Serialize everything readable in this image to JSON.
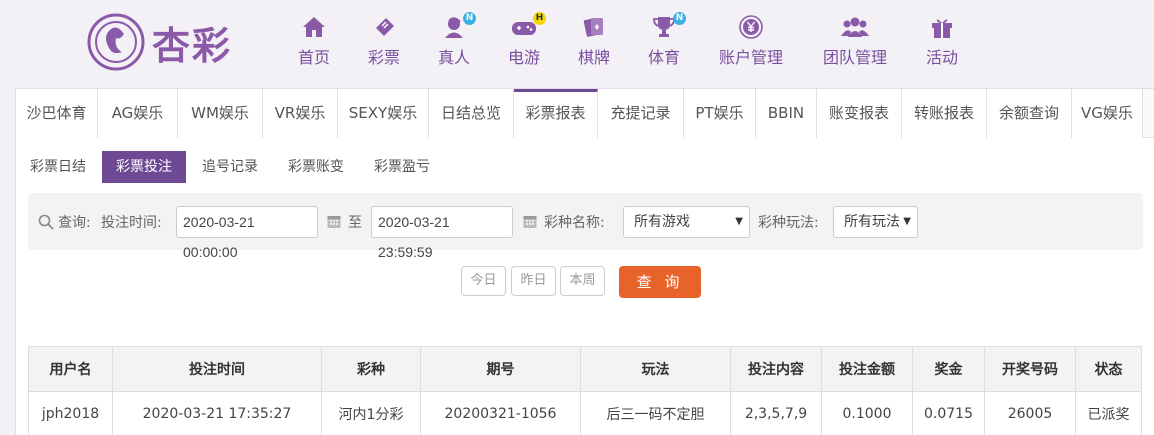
{
  "brand": {
    "name": "杏彩"
  },
  "nav": [
    {
      "label": "首页",
      "icon": "home-icon",
      "badge": ""
    },
    {
      "label": "彩票",
      "icon": "ticket-icon",
      "badge": ""
    },
    {
      "label": "真人",
      "icon": "live-dealer-icon",
      "badge": "N"
    },
    {
      "label": "电游",
      "icon": "gamepad-icon",
      "badge": "H"
    },
    {
      "label": "棋牌",
      "icon": "cards-icon",
      "badge": ""
    },
    {
      "label": "体育",
      "icon": "trophy-icon",
      "badge": "N"
    },
    {
      "label": "账户管理",
      "icon": "yen-coin-icon",
      "badge": ""
    },
    {
      "label": "团队管理",
      "icon": "team-icon",
      "badge": ""
    },
    {
      "label": "活动",
      "icon": "gift-icon",
      "badge": ""
    }
  ],
  "tabs": [
    "沙巴体育",
    "AG娱乐",
    "WM娱乐",
    "VR娱乐",
    "SEXY娱乐",
    "日结总览",
    "彩票报表",
    "充提记录",
    "PT娱乐",
    "BBIN",
    "账变报表",
    "转账报表",
    "余额查询",
    "VG娱乐"
  ],
  "active_tab": "彩票报表",
  "subtabs": [
    "彩票日结",
    "彩票投注",
    "追号记录",
    "彩票账变",
    "彩票盈亏"
  ],
  "active_subtab": "彩票投注",
  "filter": {
    "query_label": "查询:",
    "bet_time_label": "投注时间:",
    "start_time": "2020-03-21 00:00:00",
    "to_label": "至",
    "end_time": "2020-03-21 23:59:59",
    "lottery_name_label": "彩种名称:",
    "lottery_name_value": "所有游戏",
    "play_label": "彩种玩法:",
    "play_value": "所有玩法"
  },
  "quick": {
    "today": "今日",
    "yesterday": "昨日",
    "this_week": "本周"
  },
  "search_button": "查 询",
  "table": {
    "headers": [
      "用户名",
      "投注时间",
      "彩种",
      "期号",
      "玩法",
      "投注内容",
      "投注金额",
      "奖金",
      "开奖号码",
      "状态"
    ],
    "rows": [
      [
        "jph2018",
        "2020-03-21 17:35:27",
        "河内1分彩",
        "20200321-1056",
        "后三一码不定胆",
        "2,3,5,7,9",
        "0.1000",
        "0.0715",
        "26005",
        "已派奖"
      ]
    ]
  },
  "colors": {
    "brand_purple": "#6e4a94",
    "accent_orange": "#e8632a",
    "nav_text": "#7a4fa0"
  }
}
